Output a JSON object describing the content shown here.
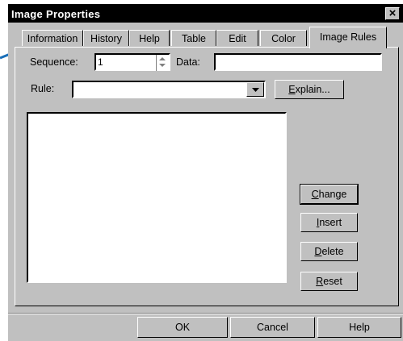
{
  "window": {
    "title": "Image Properties",
    "close_glyph": "×"
  },
  "tabs": [
    {
      "label": "Information"
    },
    {
      "label": "History"
    },
    {
      "label": "Help"
    },
    {
      "label": "Table"
    },
    {
      "label": "Edit"
    },
    {
      "label": "Color"
    },
    {
      "label": "Image Rules",
      "active": true
    }
  ],
  "form": {
    "sequence_label": "Sequence:",
    "sequence_value": "1",
    "data_label": "Data:",
    "data_value": "",
    "rule_label": "Rule:",
    "rule_value": "",
    "explain_button": {
      "underline": "E",
      "rest": "xplain..."
    }
  },
  "side_buttons": [
    {
      "underline": "C",
      "rest": "hange"
    },
    {
      "underline": "I",
      "rest": "nsert"
    },
    {
      "underline": "D",
      "rest": "elete"
    },
    {
      "underline": "R",
      "rest": "eset"
    }
  ],
  "footer": {
    "ok": "OK",
    "cancel": "Cancel",
    "help": "Help"
  },
  "colors": {
    "face": "#c0c0c0",
    "titlebar": "#000000",
    "arrow": "#1a6fb8"
  },
  "icons": {
    "arrow": "callout-arrow-icon",
    "close": "close-icon",
    "dropdown": "chevron-down-icon"
  }
}
